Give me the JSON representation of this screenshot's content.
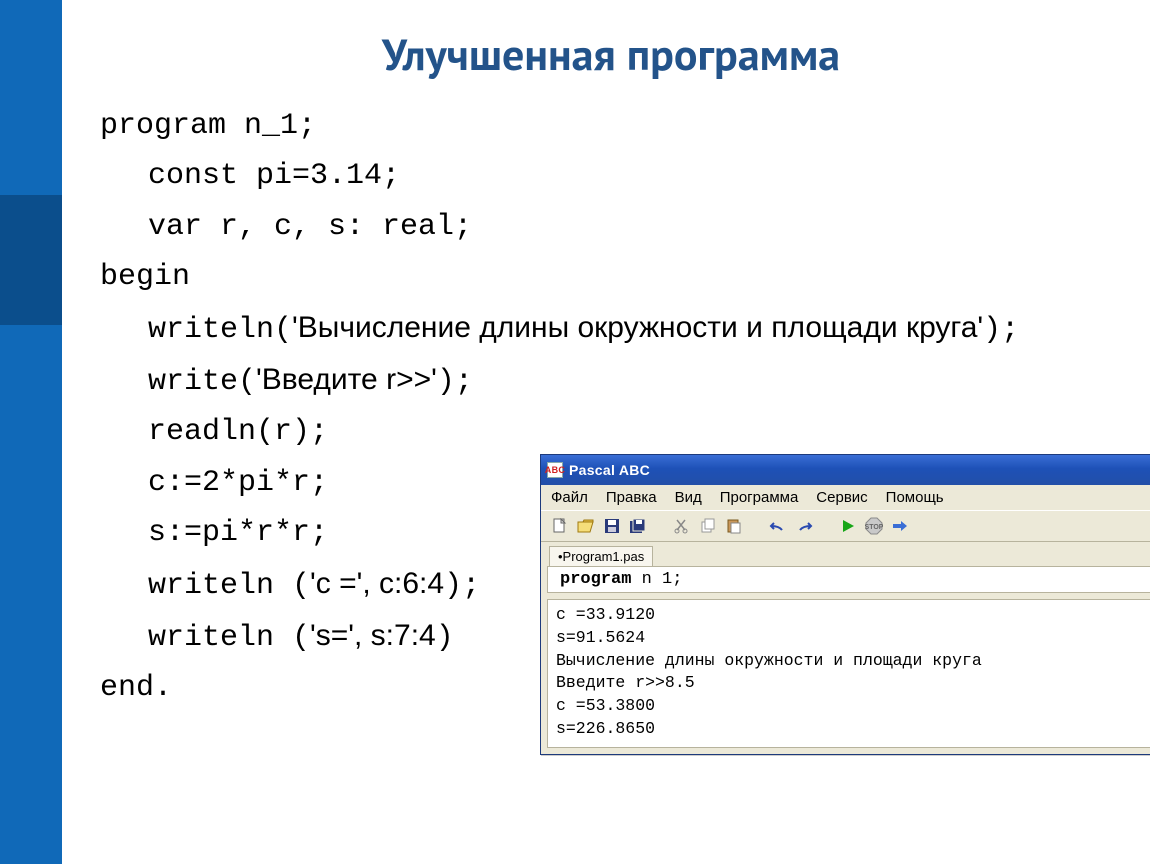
{
  "title": "Улучшенная программа",
  "code": {
    "l1a": "program",
    "l1b": " n_1;",
    "l2a": "const",
    "l2b": " pi=3.14;",
    "l3a": "var",
    "l3b": " r, c, s: real;",
    "l4": "begin",
    "l5a": "writeln(",
    "l5b": "'Вычисление длины окружности и площади круга'",
    "l5c": ");",
    "l6a": "write(",
    "l6b": "'Введите r>>'",
    "l6c": ");",
    "l7": "readln(r);",
    "l8": "c:=2*pi*r;",
    "l9": "s:=pi*r*r;",
    "l10a": "writeln (",
    "l10b": "'c =', c:6:4",
    "l10c": ");",
    "l11a": "writeln (",
    "l11b": "'s=', s:7:4",
    "l11c": ")",
    "l12": "end."
  },
  "pascal": {
    "title": "Pascal ABC",
    "icon": "ABC",
    "menu": [
      "Файл",
      "Правка",
      "Вид",
      "Программа",
      "Сервис",
      "Помощь"
    ],
    "tab": "•Program1.pas",
    "editor_kw": "program",
    "editor_rest": " n 1;",
    "output": [
      "c =33.9120",
      "s=91.5624",
      "Вычисление длины окружности и площади круга",
      "Введите r>>8.5",
      "c =53.3800",
      "s=226.8650"
    ]
  }
}
